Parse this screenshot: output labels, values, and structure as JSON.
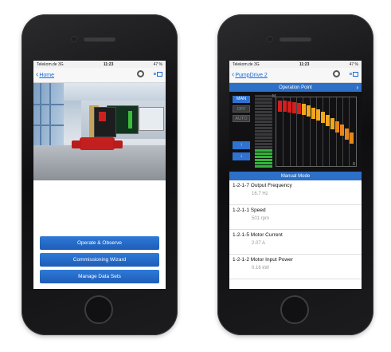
{
  "left_phone": {
    "status_bar": {
      "carrier": "Telekom.de",
      "network": "3G",
      "time": "11:23",
      "battery": "47 %"
    },
    "nav": {
      "back_label": "Home",
      "settings_icon": "gear-icon",
      "connection_icon": "bluetooth-device-icon"
    },
    "hero_image": "pump-in-factory-hall",
    "buttons": [
      {
        "label": "Operate & Observe"
      },
      {
        "label": "Commissioning Wizard"
      },
      {
        "label": "Manage Data Sets"
      }
    ]
  },
  "right_phone": {
    "status_bar": {
      "carrier": "Telekom.de",
      "network": "3G",
      "time": "11:23",
      "battery": "47 %"
    },
    "nav": {
      "back_label": "PumpDrive 2",
      "settings_icon": "gear-icon",
      "connection_icon": "bluetooth-device-icon"
    },
    "operation_point": {
      "title": "Operation Point",
      "modes": [
        "MAN",
        "OFF",
        "AUTO"
      ],
      "active_mode": "MAN",
      "control_buttons": [
        "↑",
        "↓"
      ],
      "axis_top": "M",
      "axis_bottom": "0",
      "colors": {
        "accent": "#2d70c8",
        "high": "#d61e1e",
        "mid": "#f2a81d",
        "low": "#33b53a"
      }
    },
    "manual_mode_title": "Manual Mode",
    "parameters": [
      {
        "label": "1-2-1-7 Output Frequency",
        "value": "16.7 Hz"
      },
      {
        "label": "1-2-1-1 Speed",
        "value": "501 rpm"
      },
      {
        "label": "1-2-1-5 Motor Current",
        "value": "2.07 A"
      },
      {
        "label": "1-2-1-2 Motor Input Power",
        "value": "0.16 kW"
      }
    ]
  }
}
